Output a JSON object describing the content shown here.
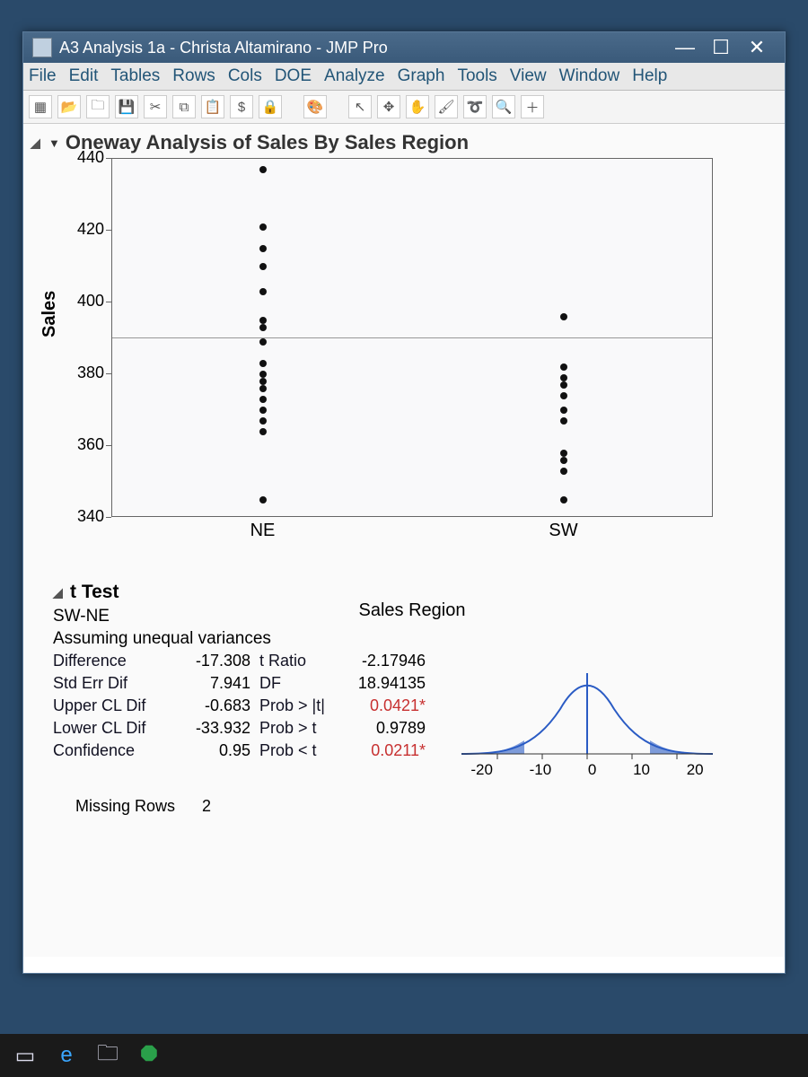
{
  "window": {
    "title": "A3 Analysis 1a - Christa Altamirano - JMP Pro"
  },
  "menu": {
    "items": [
      "File",
      "Edit",
      "Tables",
      "Rows",
      "Cols",
      "DOE",
      "Analyze",
      "Graph",
      "Tools",
      "View",
      "Window",
      "Help"
    ]
  },
  "section": {
    "title": "Oneway Analysis of Sales By Sales Region"
  },
  "chart_data": {
    "type": "scatter",
    "ylabel": "Sales",
    "xlabel": "Sales Region",
    "ylim": [
      340,
      440
    ],
    "yticks": [
      340,
      360,
      380,
      400,
      420,
      440
    ],
    "categories": [
      "NE",
      "SW"
    ],
    "series": [
      {
        "name": "NE",
        "values": [
          437,
          421,
          415,
          410,
          403,
          395,
          393,
          389,
          383,
          380,
          378,
          376,
          373,
          370,
          367,
          364,
          345
        ]
      },
      {
        "name": "SW",
        "values": [
          396,
          382,
          379,
          377,
          374,
          370,
          367,
          358,
          356,
          353,
          345
        ]
      }
    ]
  },
  "ttest": {
    "title": "t Test",
    "comparison": "SW-NE",
    "assumption": "Assuming unequal variances",
    "rows": {
      "difference": {
        "label": "Difference",
        "value": "-17.308",
        "stat_label": "t Ratio",
        "stat_value": "-2.17946"
      },
      "stderr": {
        "label": "Std Err Dif",
        "value": "7.941",
        "stat_label": "DF",
        "stat_value": "18.94135"
      },
      "upper": {
        "label": "Upper CL Dif",
        "value": "-0.683",
        "stat_label": "Prob > |t|",
        "stat_value": "0.0421*",
        "sig": true
      },
      "lower": {
        "label": "Lower CL Dif",
        "value": "-33.932",
        "stat_label": "Prob > t",
        "stat_value": "0.9789"
      },
      "conf": {
        "label": "Confidence",
        "value": "0.95",
        "stat_label": "Prob < t",
        "stat_value": "0.0211*",
        "sig": true
      }
    },
    "dist_xticks": [
      "-20",
      "-10",
      "0",
      "10",
      "20"
    ]
  },
  "missing_rows": {
    "label": "Missing Rows",
    "value": "2"
  }
}
